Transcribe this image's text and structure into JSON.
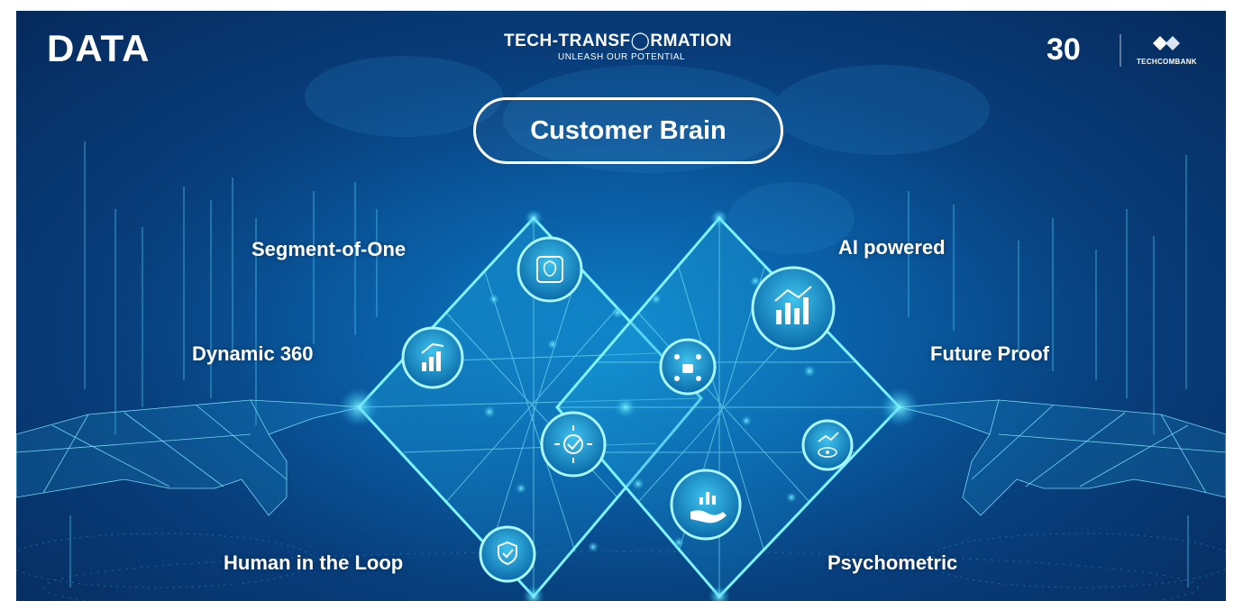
{
  "header": {
    "brand_left": "DATA",
    "tech_title": "TECH-TRANSF◯RMATION",
    "tech_subtitle": "UNLEASH OUR POTENTIAL",
    "anniversary_number": "30",
    "bank_name": "TECHCOMBANK"
  },
  "center_pill": {
    "label": "Customer Brain"
  },
  "features": {
    "segment": "Segment-of-One",
    "dynamic": "Dynamic 360",
    "human": "Human in the Loop",
    "ai": "AI powered",
    "future": "Future Proof",
    "psycho": "Psychometric"
  },
  "icons": [
    "brain-chip-icon",
    "growth-chart-icon",
    "network-lock-icon",
    "target-arrows-icon",
    "bar-chart-icon",
    "eye-chart-icon",
    "hand-chart-icon",
    "shield-network-icon"
  ],
  "colors": {
    "background": "#083f7d",
    "glow": "#3fe0ff",
    "text": "#ffffff"
  }
}
